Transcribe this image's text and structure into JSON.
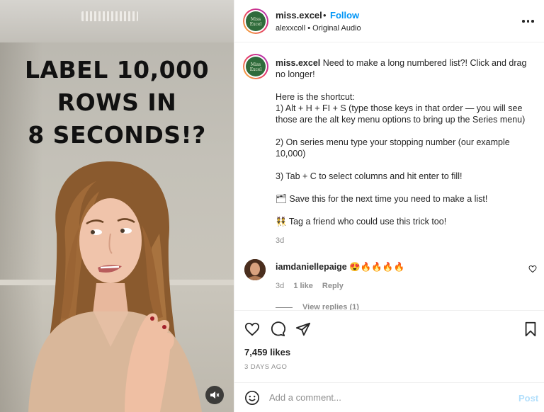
{
  "video": {
    "overlay_lines": [
      "LABEL 10,000",
      "ROWS IN",
      "8 SECONDS!?"
    ],
    "mute_icon": "speaker-muted-icon"
  },
  "header": {
    "username": "miss.excel",
    "separator": "•",
    "follow_label": "Follow",
    "audio_user": "alexxcoll",
    "audio_separator": "•",
    "audio_title": "Original Audio",
    "avatar_text": "Miss Excel",
    "more_icon": "more-options-icon"
  },
  "caption": {
    "username": "miss.excel",
    "intro": "Need to make a long numbered list?! Click and drag no longer!",
    "shortcut_heading": "Here is the shortcut:",
    "step1": "1) Alt + H + FI + S (type those keys in that order — you will see those are the alt key menu options to bring up the Series menu)",
    "step2": "2) On series menu type your stopping number (our example 10,000)",
    "step3": "3) Tab + C to select columns and hit enter to fill!",
    "save_emoji": "🗂",
    "save_text": "Save this for the next time you need to make a list!",
    "tag_emoji": "👯",
    "tag_text": "Tag a friend who could use this trick too!",
    "time": "3d"
  },
  "comment": {
    "username": "iamdaniellepaige",
    "text": "😍🔥🔥🔥🔥",
    "time": "3d",
    "likes": "1 like",
    "reply_label": "Reply",
    "view_replies": "View replies (1)"
  },
  "actions": {
    "likes": "7,459 likes",
    "date": "3 DAYS AGO"
  },
  "add_comment": {
    "placeholder": "Add a comment...",
    "post_label": "Post"
  },
  "colors": {
    "link_blue": "#0095f6",
    "post_disabled": "#b2dffc",
    "secondary_text": "#8e8e8e"
  }
}
